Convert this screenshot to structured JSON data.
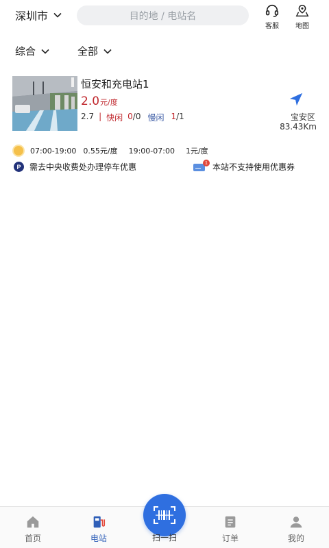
{
  "header": {
    "city": "深圳市",
    "search_placeholder": "目的地 / 电站名",
    "service_label": "客服",
    "map_label": "地图"
  },
  "filters": {
    "sort_label": "综合",
    "type_label": "全部"
  },
  "station": {
    "name": "恒安和充电站1",
    "price_value": "2.0",
    "price_unit": "元/度",
    "rating": "2.7",
    "separator": "|",
    "fast_label": "快闲",
    "fast_free": "0",
    "fast_total": "/0",
    "slow_label": "慢闲",
    "slow_free": "1",
    "slow_total": "/1",
    "district": "宝安区",
    "distance": "83.43Km",
    "tariffs": [
      {
        "time": "07:00-19:00",
        "price": "0.55元/度"
      },
      {
        "time": "19:00-07:00",
        "price": "1元/度"
      }
    ],
    "parking_badge": "P",
    "parking_note": "需去中央收费处办理停车优惠",
    "coupon_note": "本站不支持使用优惠券",
    "coupon_count": "1"
  },
  "bottom_nav": {
    "home": "首页",
    "station": "电站",
    "scan": "扫一扫",
    "orders": "订单",
    "mine": "我的"
  },
  "colors": {
    "accent_blue": "#2f6fe0",
    "price_red": "#c0272d",
    "slow_blue": "#3b5ba5"
  }
}
